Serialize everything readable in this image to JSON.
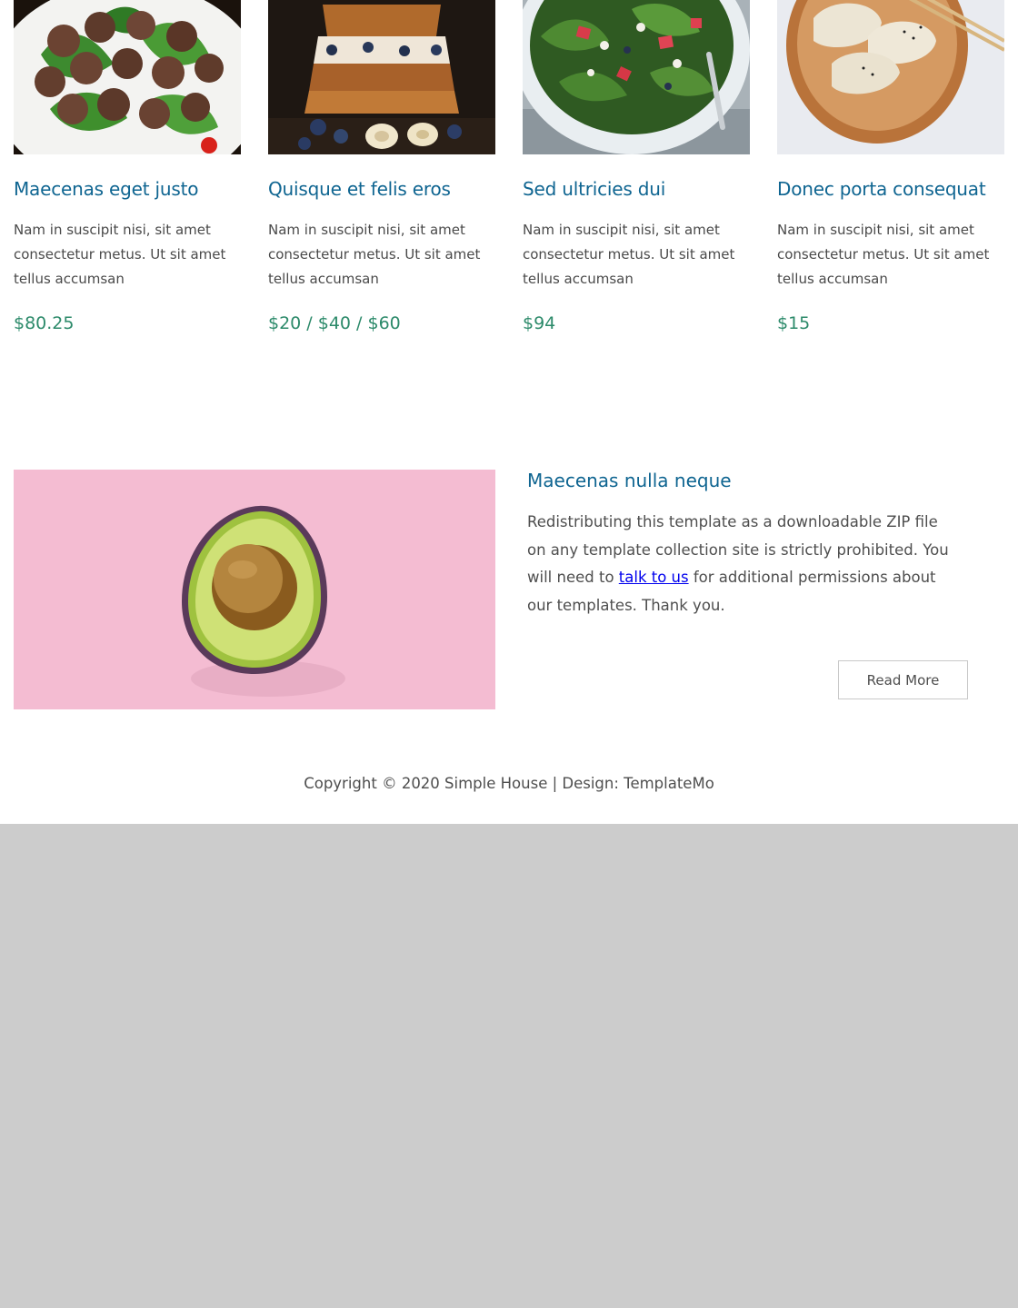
{
  "menu_items": [
    {
      "title": "Maecenas eget justo",
      "description": "Nam in suscipit nisi, sit amet consectetur metus. Ut sit amet tellus accumsan",
      "price": "$80.25",
      "image": "meatballs-on-salad-image"
    },
    {
      "title": "Quisque et felis eros",
      "description": "Nam in suscipit nisi, sit amet consectetur metus. Ut sit amet tellus accumsan",
      "price": "$20 / $40 / $60",
      "image": "french-toast-blueberries-image"
    },
    {
      "title": "Sed ultricies dui",
      "description": "Nam in suscipit nisi, sit amet consectetur metus. Ut sit amet tellus accumsan",
      "price": "$94",
      "image": "green-salad-bowl-image"
    },
    {
      "title": "Donec porta consequat",
      "description": "Nam in suscipit nisi, sit amet consectetur metus. Ut sit amet tellus accumsan",
      "price": "$15",
      "image": "dumplings-plate-image"
    }
  ],
  "feature": {
    "title": "Maecenas nulla neque",
    "text_before": "Redistributing this template as a downloadable ZIP file on any template collection site is strictly prohibited. You will need to ",
    "link_text": "talk to us",
    "text_after": " for additional permissions about our templates. Thank you.",
    "button_label": "Read More",
    "image": "avocado-half-image"
  },
  "footer": {
    "copyright": "Copyright © 2020 Simple House | Design: TemplateMo"
  },
  "colors": {
    "title": "#0f6591",
    "price": "#2c8a6a",
    "body_text": "#4e4e4e",
    "link": "#0000ee",
    "page_background": "#ffffff",
    "viewport_background": "#cccccc",
    "avocado_backdrop": "#f4bcd2"
  }
}
